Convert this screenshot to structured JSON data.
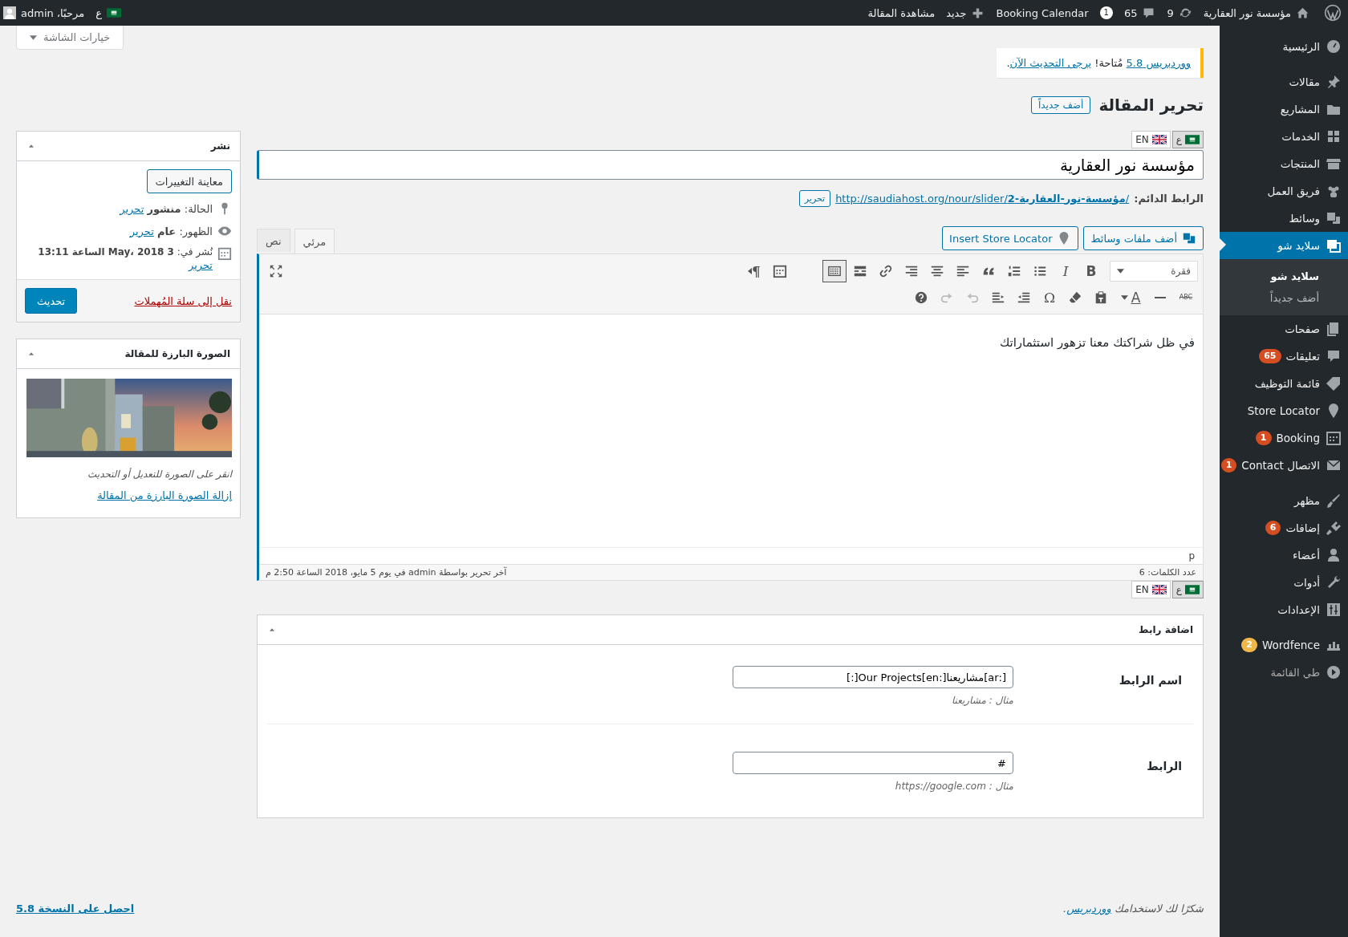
{
  "admin_bar": {
    "items": [
      {
        "label": "مؤسسة نور العقارية"
      },
      {
        "label": "9"
      },
      {
        "label": "65"
      },
      {
        "label": "Booking Calendar",
        "badge": "1"
      },
      {
        "label": "جديد"
      },
      {
        "label": "مشاهدة المقالة"
      }
    ],
    "secondary": [
      {
        "label": "ع"
      },
      {
        "label": "مرحبًا، admin"
      }
    ]
  },
  "sidebar": {
    "groups": [
      [
        {
          "label": "الرئيسية",
          "selected": false
        }
      ],
      [
        {
          "label": "مقالات",
          "selected": false
        },
        {
          "label": "المشاريع",
          "selected": false
        },
        {
          "label": "الخدمات",
          "selected": false
        },
        {
          "label": "المنتجات",
          "selected": false
        },
        {
          "label": "فريق العمل",
          "selected": false
        },
        {
          "label": "وسائط",
          "selected": false
        },
        {
          "label": "سلايد شو",
          "selected": true,
          "children": [
            {
              "label": "سلايد شو",
              "selected": true
            },
            {
              "label": "أضف جديداً",
              "selected": false
            }
          ]
        },
        {
          "label": "صفحات",
          "selected": false
        },
        {
          "label": "تعليقات",
          "selected": false,
          "badge": "65",
          "color": "#d54e21"
        },
        {
          "label": "قائمة التوظيف",
          "selected": false
        },
        {
          "label": "Store Locator",
          "selected": false
        },
        {
          "label": "Booking",
          "selected": false,
          "badge": "1",
          "color": "#d54e21"
        },
        {
          "label": "الاتصال Contact",
          "selected": false,
          "badge": "1",
          "color": "#d54e21"
        }
      ],
      [
        {
          "label": "مظهر",
          "selected": false
        },
        {
          "label": "إضافات",
          "selected": false,
          "badge": "6",
          "color": "#d54e21"
        },
        {
          "label": "أعضاء",
          "selected": false
        },
        {
          "label": "أدوات",
          "selected": false
        },
        {
          "label": "الإعدادات",
          "selected": false
        }
      ],
      [
        {
          "label": "Wordfence",
          "selected": false,
          "badge": "2",
          "color": "#f0b849"
        },
        {
          "label": "طي القائمة",
          "selected": false,
          "kind": "collapse"
        }
      ]
    ]
  },
  "screen_options": "خيارات الشاشة",
  "notice": {
    "link": "ووردبريس 5.8",
    "text": " مُتاحة! ",
    "action_link": "يرجى التحديث الآن",
    "end": "."
  },
  "heading": "تحرير المقالة",
  "add_new": "أضف جديداً",
  "language_switch": [
    {
      "label": "ع",
      "selected": true
    },
    {
      "label": "EN",
      "selected": false
    }
  ],
  "title_value": "مؤسسة نور العقارية",
  "permalink": {
    "label": "الرابط الدائم:",
    "url": "http://saudiahost.org/nour/slider/**مؤسسة-نور-العقارية-2**/",
    "edit": "تحرير"
  },
  "media_buttons": [
    "أضف ملفات وسائط",
    "Insert Store Locator"
  ],
  "editor_tabs": [
    {
      "label": "مرئي",
      "selected": true
    },
    {
      "label": "نص",
      "selected": false
    }
  ],
  "toolbar": {
    "row_1": [
      {
        "kind": "select",
        "text": "فقرة",
        "selected": false
      },
      {
        "kind": "bold",
        "text": "B",
        "selected": false
      },
      {
        "kind": "italic",
        "text": "I",
        "selected": false
      },
      {
        "kind": "bullet-list",
        "selected": false
      },
      {
        "kind": "number-list",
        "selected": false
      },
      {
        "kind": "quote",
        "selected": false
      },
      {
        "kind": "align-left",
        "selected": false
      },
      {
        "kind": "align-center",
        "selected": false
      },
      {
        "kind": "align-right",
        "selected": false
      },
      {
        "kind": "link",
        "selected": false
      },
      {
        "kind": "read-more",
        "selected": false
      },
      {
        "kind": "toolbar-toggle",
        "selected": true
      },
      {
        "kind": "calendar",
        "selected": false
      },
      {
        "kind": "direction",
        "text": "¶",
        "selected": false
      },
      {
        "kind": "fullscreen",
        "selected": false
      }
    ],
    "row_2": [
      {
        "kind": "strike",
        "text": "ABC",
        "disabled": false
      },
      {
        "kind": "hr",
        "disabled": false
      },
      {
        "kind": "color",
        "text": "A",
        "disabled": false
      },
      {
        "kind": "paste",
        "disabled": false
      },
      {
        "kind": "eraser",
        "disabled": false
      },
      {
        "kind": "char",
        "text": "Ω",
        "disabled": false
      },
      {
        "kind": "outdent",
        "disabled": false
      },
      {
        "kind": "indent",
        "disabled": false
      },
      {
        "kind": "undo",
        "disabled": true
      },
      {
        "kind": "redo",
        "disabled": true
      },
      {
        "kind": "help",
        "disabled": false
      }
    ]
  },
  "content": "في ظل شراكتك معنا تزهور استثماراتك",
  "path": "p",
  "word_count": "عدد الكلمات: 6",
  "last_edit": "آخر تحرير بواسطة admin في يوم 5 مايو، 2018 الساعة 2:50 م",
  "language_switch_2": [
    {
      "label": "ع",
      "selected": true
    },
    {
      "label": "EN",
      "selected": false
    }
  ],
  "link_box": {
    "title": "اضافة رابط",
    "fields": [
      {
        "label": "اسم الرابط",
        "value": "[:ar]مشاريعنا[:en]Our Projects[:]",
        "hint": "مثال : مشاريعنا"
      },
      {
        "label": "الرابط",
        "value": "#",
        "hint": "مثال : https://google.com"
      }
    ]
  },
  "publish": {
    "title": "نشر",
    "preview": "معاينة التغييرات",
    "status": "الحالة: **منشور**",
    "visibility": "الظهور: **عام**",
    "date": "نُشر في: **3 May، 2018 الساعة 13:11**",
    "edit": [
      "تحرير",
      "تحرير",
      "تحرير"
    ],
    "trash": "نقل إلى سلة المُهملات",
    "update": "تحديث"
  },
  "featured": {
    "title": "الصورة البارزة للمقالة",
    "hint": "انقر على الصورة للتعديل أو التحديث",
    "remove": "إزالة الصورة البارزة من المقالة"
  },
  "footer": {
    "thanks": "شكرًا لك لاستخدامك ",
    "thanks_link": "ووردبريس",
    "thanks_end": ".",
    "version": "احصل على النسخة 5.8"
  }
}
